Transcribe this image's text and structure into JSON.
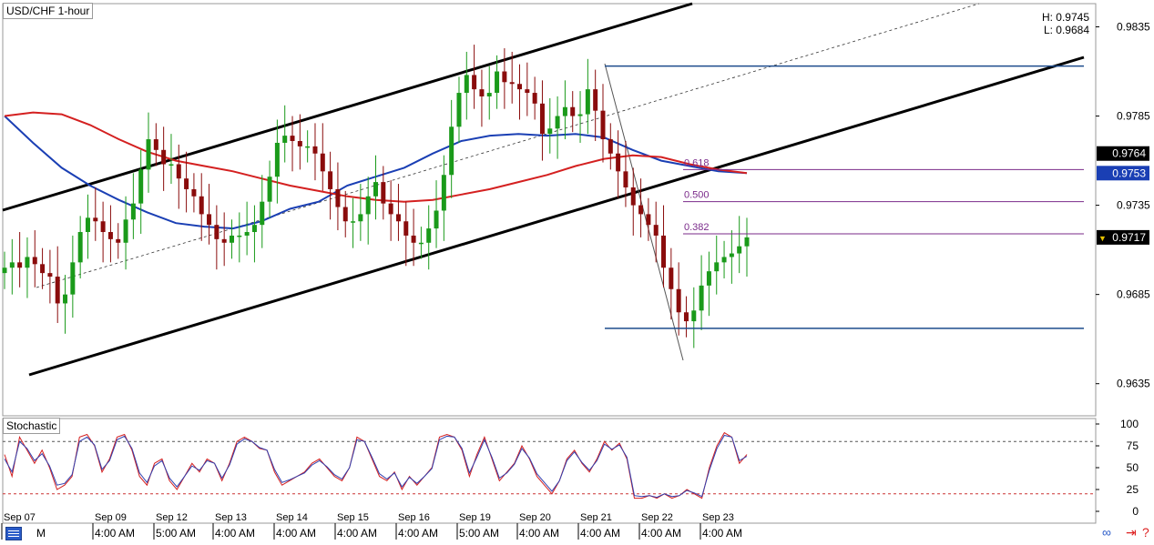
{
  "chart_data": [
    {
      "type": "candlestick",
      "title": "USD/CHF 1-hour",
      "high_label": "H: 0.9745",
      "low_label": "L: 0.9684",
      "y_ticks": [
        "0.9835",
        "0.9785",
        "0.9735",
        "0.9685",
        "0.9635"
      ],
      "y_tick_values": [
        0.9835,
        0.9785,
        0.9735,
        0.9685,
        0.9635
      ],
      "ylim": [
        0.9617,
        0.9848
      ],
      "price_tags": [
        {
          "value": 0.9764,
          "text": "0.9764",
          "color": "#000000"
        },
        {
          "value": 0.9753,
          "text": "0.9753",
          "color": "#1a3fb4"
        },
        {
          "value": 0.9717,
          "text": "0.9717",
          "color": "#000000",
          "marker": "▼"
        }
      ],
      "fib_levels": [
        {
          "label": "0.618",
          "value": 0.9755
        },
        {
          "label": "0.500",
          "value": 0.9737
        },
        {
          "label": "0.382",
          "value": 0.9719
        }
      ],
      "horizontal_levels": [
        0.9813,
        0.9666
      ],
      "close_series": [
        0.97,
        0.9703,
        0.97,
        0.9706,
        0.9702,
        0.9697,
        0.9695,
        0.968,
        0.9685,
        0.9703,
        0.972,
        0.9728,
        0.9726,
        0.972,
        0.9716,
        0.9714,
        0.9727,
        0.9736,
        0.9755,
        0.9772,
        0.9766,
        0.9758,
        0.9758,
        0.975,
        0.9744,
        0.974,
        0.973,
        0.9724,
        0.9716,
        0.9714,
        0.9718,
        0.9718,
        0.972,
        0.9724,
        0.9737,
        0.9751,
        0.977,
        0.9774,
        0.9771,
        0.9768,
        0.9768,
        0.9764,
        0.9754,
        0.9744,
        0.9734,
        0.9726,
        0.9726,
        0.973,
        0.974,
        0.9748,
        0.9736,
        0.973,
        0.9726,
        0.9718,
        0.9714,
        0.9714,
        0.9722,
        0.9732,
        0.9752,
        0.9779,
        0.9798,
        0.9808,
        0.98,
        0.9796,
        0.9798,
        0.981,
        0.9804,
        0.9803,
        0.98,
        0.9798,
        0.9792,
        0.9775,
        0.9778,
        0.9785,
        0.979,
        0.9785,
        0.9786,
        0.98,
        0.9788,
        0.9772,
        0.9764,
        0.9754,
        0.9745,
        0.9735,
        0.973,
        0.9724,
        0.9718,
        0.97,
        0.9688,
        0.9675,
        0.967,
        0.9676,
        0.969,
        0.9698,
        0.9703,
        0.9706,
        0.9708,
        0.9712,
        0.9717
      ],
      "moving_averages": [
        {
          "color": "#1a3fb4",
          "values": [
            0.9785,
            0.977,
            0.9756,
            0.9746,
            0.9738,
            0.9731,
            0.9725,
            0.9723,
            0.9722,
            0.9726,
            0.9733,
            0.9737,
            0.9746,
            0.9751,
            0.9756,
            0.9764,
            0.9771,
            0.9774,
            0.9775,
            0.9774,
            0.9775,
            0.9773,
            0.9766,
            0.976,
            0.9757,
            0.9754,
            0.9753
          ]
        },
        {
          "color": "#d42020",
          "values": [
            0.9785,
            0.9787,
            0.9786,
            0.978,
            0.9772,
            0.9765,
            0.976,
            0.9757,
            0.9754,
            0.975,
            0.9746,
            0.9743,
            0.974,
            0.9738,
            0.9737,
            0.9738,
            0.9741,
            0.9744,
            0.9748,
            0.9752,
            0.9757,
            0.9761,
            0.9763,
            0.9762,
            0.9758,
            0.9755,
            0.9753
          ]
        }
      ],
      "trendlines": [
        "upper-channel",
        "lower-channel",
        "mid-channel-dashed",
        "fib-swing-diagonal"
      ],
      "x_date_labels": [
        "Sep 07",
        "Sep 09",
        "Sep 12",
        "Sep 13",
        "Sep 14",
        "Sep 15",
        "Sep 16",
        "Sep 19",
        "Sep 20",
        "Sep 21",
        "Sep 22",
        "Sep 23"
      ],
      "x_time_labels": [
        "M",
        "4:00 AM",
        "5:00 AM",
        "4:00 AM",
        "4:00 AM",
        "4:00 AM",
        "4:00 AM",
        "5:00 AM",
        "4:00 AM",
        "4:00 AM",
        "4:00 AM",
        "4:00 AM"
      ],
      "colors": {
        "bull": "#1a9a1a",
        "bear": "#8a0c0c",
        "ma_fast": "#1a3fb4",
        "ma_slow": "#d42020",
        "fib": "#7a2a8a",
        "level": "#1c4b8c"
      }
    },
    {
      "type": "line",
      "title": "Stochastic",
      "ylim": [
        0,
        100
      ],
      "y_ticks": [
        "100",
        "75",
        "50",
        "25",
        "0"
      ],
      "y_tick_values": [
        100,
        75,
        50,
        25,
        0
      ],
      "reference_lines": [
        80,
        20
      ],
      "series": [
        {
          "color": "#d42020",
          "values": [
            65,
            40,
            85,
            70,
            55,
            70,
            50,
            25,
            30,
            40,
            85,
            88,
            75,
            45,
            60,
            85,
            88,
            70,
            40,
            30,
            55,
            60,
            35,
            25,
            40,
            55,
            45,
            60,
            55,
            35,
            55,
            80,
            85,
            80,
            72,
            70,
            45,
            30,
            35,
            40,
            45,
            55,
            60,
            50,
            40,
            35,
            50,
            85,
            80,
            60,
            40,
            35,
            45,
            25,
            40,
            30,
            40,
            50,
            85,
            88,
            85,
            70,
            40,
            65,
            85,
            60,
            35,
            45,
            55,
            75,
            60,
            40,
            30,
            20,
            35,
            60,
            70,
            55,
            45,
            60,
            80,
            70,
            78,
            60,
            15,
            15,
            18,
            15,
            20,
            15,
            18,
            25,
            20,
            15,
            50,
            75,
            90,
            85,
            55,
            65
          ]
        },
        {
          "color": "#3040b0",
          "values": [
            60,
            45,
            80,
            72,
            58,
            66,
            52,
            30,
            32,
            42,
            80,
            85,
            76,
            48,
            58,
            82,
            86,
            72,
            44,
            33,
            52,
            58,
            38,
            28,
            40,
            52,
            47,
            58,
            55,
            38,
            53,
            77,
            83,
            80,
            73,
            70,
            48,
            33,
            36,
            40,
            44,
            53,
            58,
            51,
            42,
            37,
            50,
            82,
            80,
            62,
            43,
            37,
            44,
            28,
            39,
            32,
            40,
            49,
            82,
            86,
            85,
            72,
            44,
            62,
            82,
            62,
            38,
            44,
            54,
            72,
            61,
            43,
            33,
            23,
            35,
            58,
            68,
            56,
            47,
            58,
            77,
            71,
            76,
            62,
            18,
            17,
            18,
            16,
            20,
            17,
            18,
            24,
            21,
            17,
            47,
            72,
            87,
            85,
            58,
            63
          ]
        }
      ]
    }
  ],
  "toolbar": {
    "icons": [
      "grid-icon",
      "link-icon",
      "arrow-icon",
      "help-icon"
    ],
    "help_glyph": "?"
  }
}
